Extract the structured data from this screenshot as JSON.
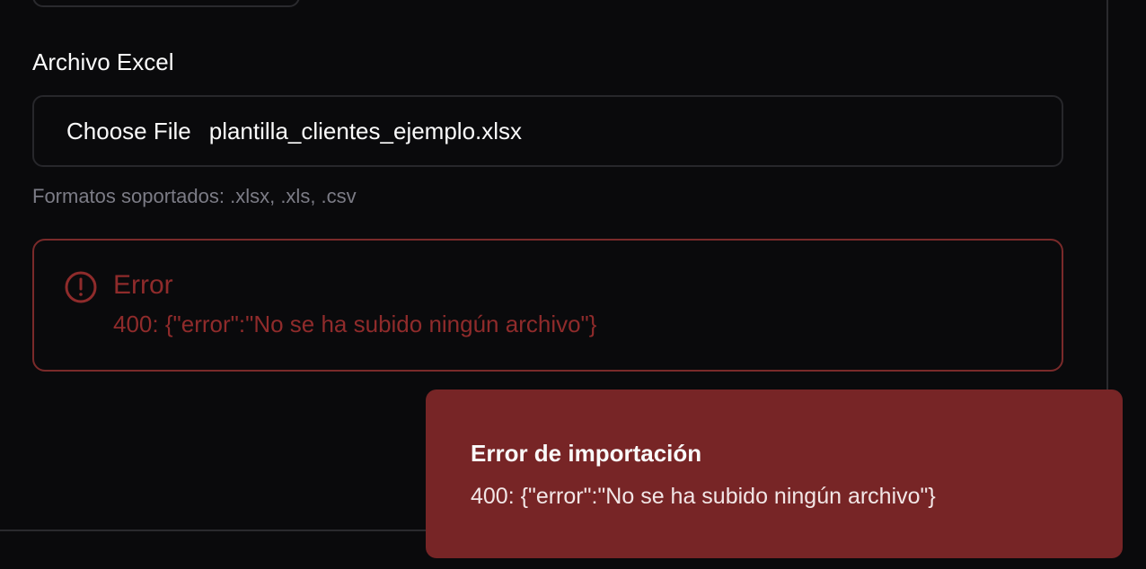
{
  "form": {
    "file_label": "Archivo Excel",
    "choose_file_label": "Choose File",
    "file_name": "plantilla_clientes_ejemplo.xlsx",
    "help_text": "Formatos soportados: .xlsx, .xls, .csv"
  },
  "alert": {
    "icon": "alert-circle-icon",
    "title": "Error",
    "message": "400: {\"error\":\"No se ha subido ningún archivo\"}",
    "color": "#8f2b2b",
    "border_color": "#7a2a2a"
  },
  "toast": {
    "title": "Error de importación",
    "message": "400: {\"error\":\"No se ha subido ningún archivo\"}",
    "background": "#772526"
  }
}
